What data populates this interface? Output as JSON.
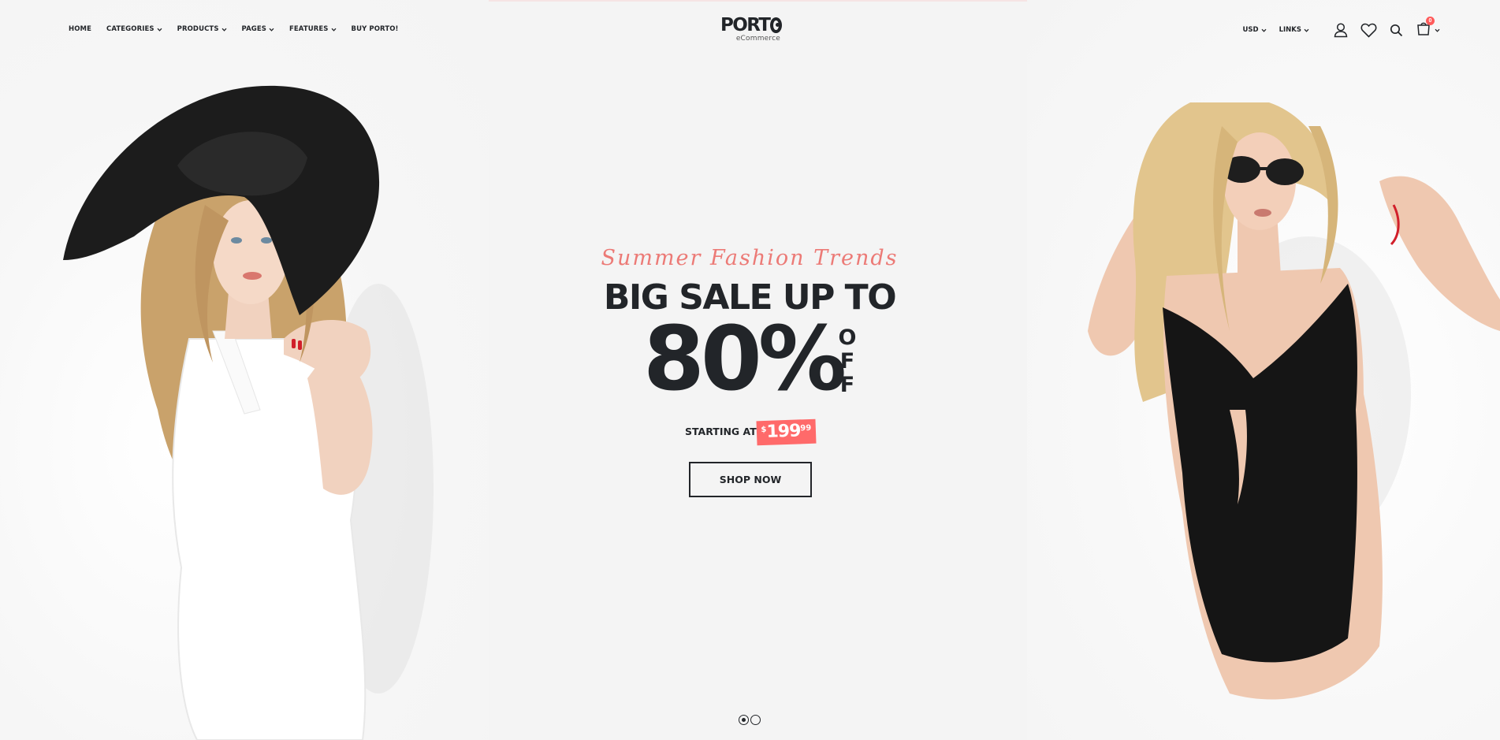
{
  "header": {
    "nav": [
      {
        "label": "HOME",
        "dropdown": false
      },
      {
        "label": "CATEGORIES",
        "dropdown": true
      },
      {
        "label": "PRODUCTS",
        "dropdown": true
      },
      {
        "label": "PAGES",
        "dropdown": true
      },
      {
        "label": "FEATURES",
        "dropdown": true
      },
      {
        "label": "BUY PORTO!",
        "dropdown": false
      }
    ],
    "logo": {
      "main": "PORT",
      "sub": "eCommerce"
    },
    "currency": "USD",
    "links": "LINKS",
    "cart_count": "0",
    "icons": [
      "user-icon",
      "heart-icon",
      "search-icon",
      "cart-icon"
    ]
  },
  "hero": {
    "script_title": "Summer Fashion Trends",
    "headline": "BIG SALE UP TO",
    "percent": "80%",
    "off_letters": [
      "O",
      "F",
      "F"
    ],
    "starting_label": "STARTING AT",
    "price": {
      "currency": "$",
      "main": "199",
      "cents": "99"
    },
    "cta": "SHOP NOW",
    "slides": 2,
    "active_slide": 1
  },
  "colors": {
    "accent": "#ff6a6a",
    "script": "#ec7a76",
    "dark": "#222529",
    "background": "#f4f4f4"
  }
}
